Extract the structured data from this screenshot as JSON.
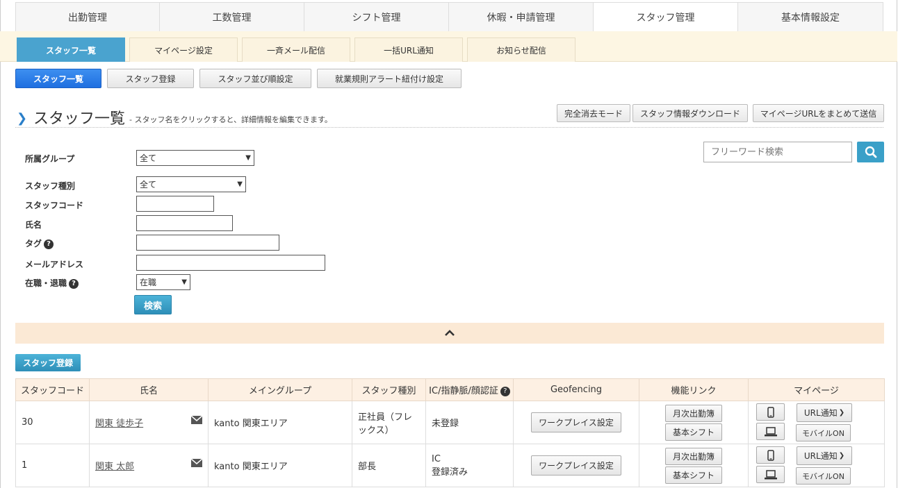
{
  "top_nav": [
    "出勤管理",
    "工数管理",
    "シフト管理",
    "休暇・申請管理",
    "スタッフ管理",
    "基本情報設定"
  ],
  "sub_nav": [
    "スタッフ一覧",
    "マイページ設定",
    "一斉メール配信",
    "一括URL通知",
    "お知らせ配信"
  ],
  "tertiary_nav": [
    "スタッフ一覧",
    "スタッフ登録",
    "スタッフ並び順設定",
    "就業規則アラート紐付け設定"
  ],
  "heading": {
    "title": "スタッフ一覧",
    "description": "- スタッフ名をクリックすると、詳細情報を編集できます。"
  },
  "header_buttons": [
    "完全消去モード",
    "スタッフ情報ダウンロード",
    "マイページURLをまとめて送信"
  ],
  "freeword": {
    "placeholder": "フリーワード検索"
  },
  "filters": {
    "group_label": "所属グループ",
    "group_value": "全て",
    "type_label": "スタッフ種別",
    "type_value": "全て",
    "code_label": "スタッフコード",
    "name_label": "氏名",
    "tag_label": "タグ",
    "email_label": "メールアドレス",
    "status_label": "在職・退職",
    "status_value": "在職",
    "search_button": "検索"
  },
  "register_button": "スタッフ登録",
  "table": {
    "headers": [
      "スタッフコード",
      "氏名",
      "メイングループ",
      "スタッフ種別",
      "IC/指静脈/顔認証",
      "Geofencing",
      "機能リンク",
      "マイページ"
    ],
    "rows": [
      {
        "code": "30",
        "name": "関東 徒歩子",
        "group": "kanto 関東エリア",
        "type": "正社員（フレックス）",
        "ic": "未登録",
        "ic2": "",
        "geo": "ワークプレイス設定",
        "link1": "月次出勤簿",
        "link2": "基本シフト",
        "url_notice": "URL通知",
        "mobile": "モバイルON"
      },
      {
        "code": "1",
        "name": "関東 太郎",
        "group": "kanto 関東エリア",
        "type": "部長",
        "ic": "IC",
        "ic2": "登録済み",
        "geo": "ワークプレイス設定",
        "link1": "月次出勤簿",
        "link2": "基本シフト",
        "url_notice": "URL通知",
        "mobile": "モバイルON"
      }
    ]
  },
  "colors": {
    "accent": "#4aa3cf",
    "primary": "#1f6fe0",
    "subnav_bg": "#fdf6e3",
    "collapse_bg": "#fbe9d5"
  }
}
